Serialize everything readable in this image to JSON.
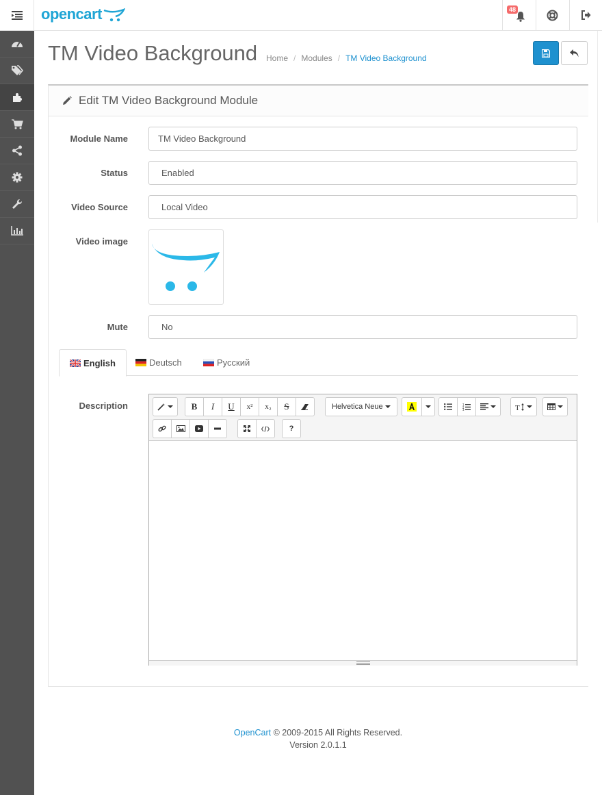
{
  "header": {
    "logo_text": "opencart",
    "notification_count": "48"
  },
  "sidebar": {
    "items": [
      {
        "icon": "dashboard-icon"
      },
      {
        "icon": "tags-icon"
      },
      {
        "icon": "puzzle-icon"
      },
      {
        "icon": "cart-icon"
      },
      {
        "icon": "share-icon"
      },
      {
        "icon": "gear-icon"
      },
      {
        "icon": "wrench-icon"
      },
      {
        "icon": "bar-chart-icon"
      }
    ]
  },
  "page": {
    "title": "TM Video Background",
    "breadcrumb": [
      "Home",
      "Modules",
      "TM Video Background"
    ]
  },
  "panel": {
    "heading": "Edit TM Video Background Module"
  },
  "form": {
    "module_name": {
      "label": "Module Name",
      "value": "TM Video Background"
    },
    "status": {
      "label": "Status",
      "value": "Enabled"
    },
    "video_source": {
      "label": "Video Source",
      "value": "Local Video"
    },
    "video_image": {
      "label": "Video image"
    },
    "mute": {
      "label": "Mute",
      "value": "No"
    },
    "description": {
      "label": "Description"
    }
  },
  "tabs": [
    "English",
    "Deutsch",
    "Русский"
  ],
  "editor": {
    "font_name": "Helvetica Neue",
    "buttons": {
      "bold": "B",
      "italic": "I",
      "underline": "U",
      "superscript": "x²",
      "subscript": "x₂",
      "strikethrough": "S",
      "help": "?"
    }
  },
  "footer": {
    "link_text": "OpenCart",
    "copyright": " © 2009-2015 All Rights Reserved.",
    "version": "Version 2.0.1.1"
  },
  "colors": {
    "accent": "#1e91cf",
    "logo": "#1fa5d5",
    "sidebar_bg": "#515151",
    "badge": "#f56b6b"
  }
}
